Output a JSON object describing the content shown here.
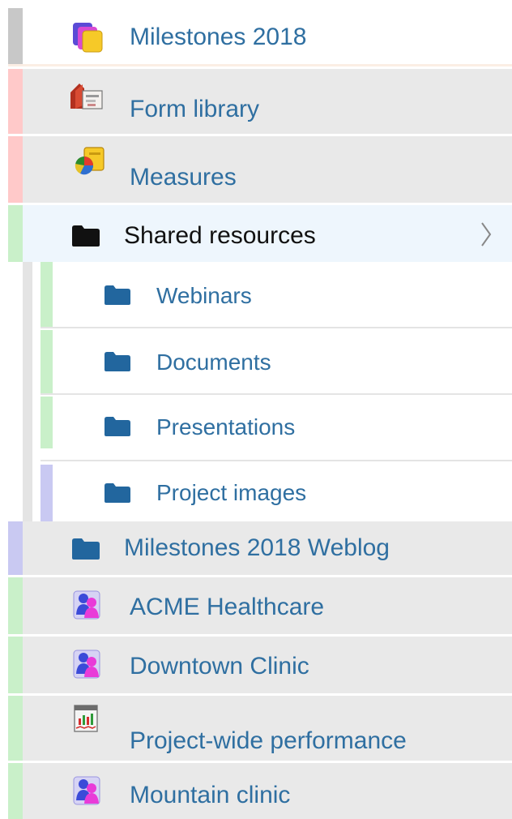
{
  "colors": {
    "label": "#2f6fa1",
    "label_active": "#111111",
    "row_bg": "#e9e9e9",
    "row_bg_active": "#eef6fd",
    "row_bg_sub": "#ffffff",
    "bar_gray": "#c8c8c8",
    "bar_red": "#ffc9c9",
    "bar_green": "#c9f0c9",
    "bar_blue": "#c9c9f2",
    "folder_blue": "#22669e"
  },
  "nav": {
    "items": [
      {
        "label": "Milestones 2018",
        "icon": "project-stack-icon"
      },
      {
        "label": "Form library",
        "icon": "form-library-icon"
      },
      {
        "label": "Measures",
        "icon": "measures-pie-icon"
      },
      {
        "label": "Shared resources",
        "icon": "folder-icon",
        "active": true,
        "expand_icon": "chevron-right-icon"
      },
      {
        "label": "Webinars",
        "icon": "folder-icon",
        "level": 2
      },
      {
        "label": "Documents",
        "icon": "folder-icon",
        "level": 2
      },
      {
        "label": "Presentations",
        "icon": "folder-icon",
        "level": 2
      },
      {
        "label": "Project images",
        "icon": "folder-icon",
        "level": 2
      },
      {
        "label": "Milestones 2018 Weblog",
        "icon": "folder-icon"
      },
      {
        "label": "ACME Healthcare",
        "icon": "team-people-icon"
      },
      {
        "label": "Downtown Clinic",
        "icon": "team-people-icon"
      },
      {
        "label": "Project-wide performance",
        "icon": "performance-report-icon"
      },
      {
        "label": "Mountain clinic",
        "icon": "team-people-icon"
      }
    ]
  }
}
